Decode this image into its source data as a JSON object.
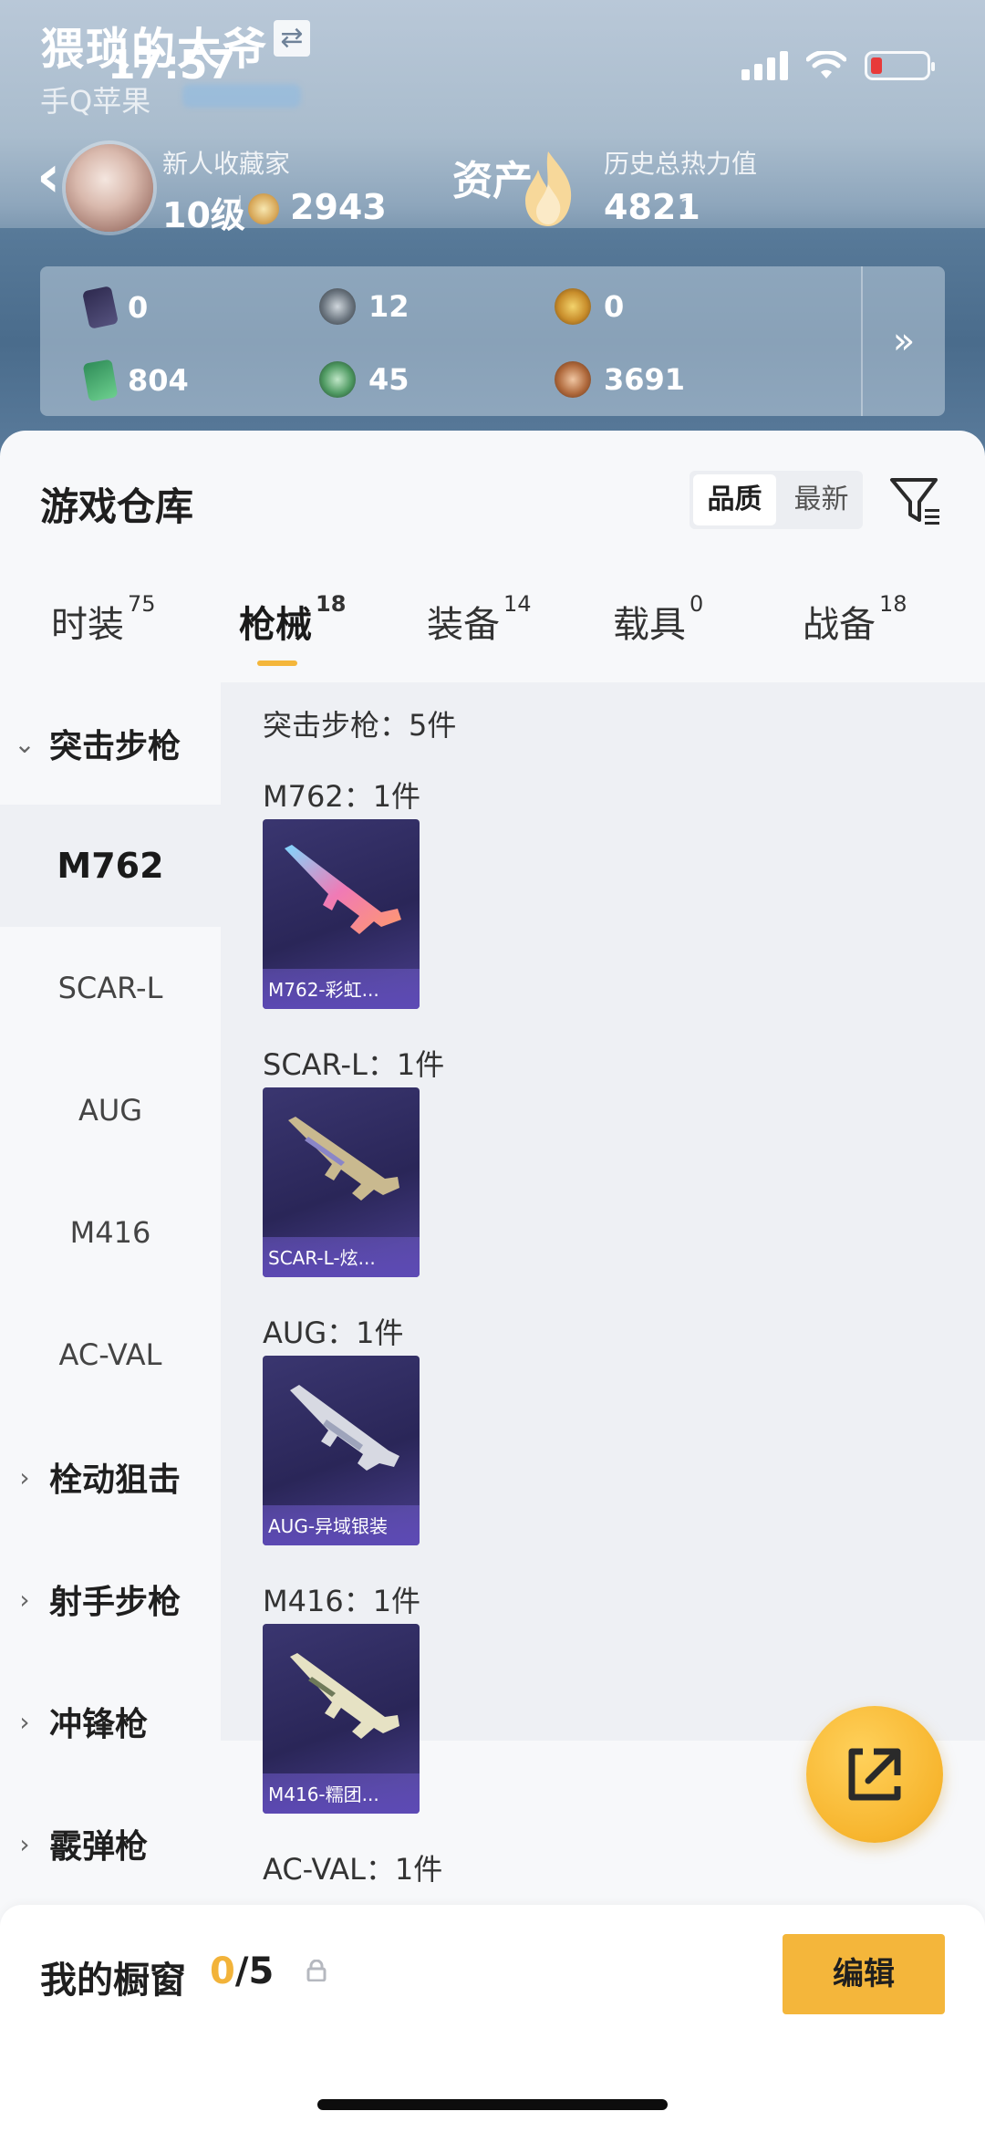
{
  "header": {
    "username": "猥琐的大爷",
    "time": "17:57",
    "platform": "手Q苹果",
    "badge_title": "新人收藏家",
    "level": "10级",
    "coins": "2943",
    "asset_label": "资产",
    "history_label": "历史总热力值",
    "history_value": "4821",
    "help": "?"
  },
  "stats": [
    {
      "icon": "card-icon",
      "value": "0"
    },
    {
      "icon": "dial-icon",
      "value": "12"
    },
    {
      "icon": "gold-token-icon",
      "value": "0"
    },
    {
      "icon": "cash-icon",
      "value": "804"
    },
    {
      "icon": "green-coin-icon",
      "value": "45"
    },
    {
      "icon": "bronze-coin-icon",
      "value": "3691"
    }
  ],
  "stats_more": "»",
  "warehouse": {
    "title": "游戏仓库",
    "sort_options": [
      "品质",
      "最新"
    ],
    "tabs": [
      {
        "label": "时装",
        "count": "75"
      },
      {
        "label": "枪械",
        "count": "18"
      },
      {
        "label": "装备",
        "count": "14"
      },
      {
        "label": "载具",
        "count": "0"
      },
      {
        "label": "战备",
        "count": "18"
      }
    ],
    "active_tab": 1
  },
  "sidebar": {
    "expanded_category": "突击步枪",
    "subitems": [
      "M762",
      "SCAR-L",
      "AUG",
      "M416",
      "AC-VAL"
    ],
    "collapsed_categories": [
      "栓动狙击",
      "射手步枪",
      "冲锋枪",
      "霰弹枪"
    ]
  },
  "content": {
    "summary": "突击步枪：5件",
    "groups": [
      {
        "header": "M762：1件",
        "item": "M762-彩虹..."
      },
      {
        "header": "SCAR-L：1件",
        "item": "SCAR-L-炫..."
      },
      {
        "header": "AUG：1件",
        "item": "AUG-异域银装"
      },
      {
        "header": "M416：1件",
        "item": "M416-糯团..."
      },
      {
        "header": "AC-VAL：1件",
        "item": ""
      }
    ]
  },
  "showcase": {
    "label": "我的橱窗",
    "current": "0",
    "total": "/5",
    "edit": "编辑"
  },
  "colors": {
    "accent": "#f4b63b",
    "panel": "#f7f8fa",
    "content": "#eef0f4"
  }
}
